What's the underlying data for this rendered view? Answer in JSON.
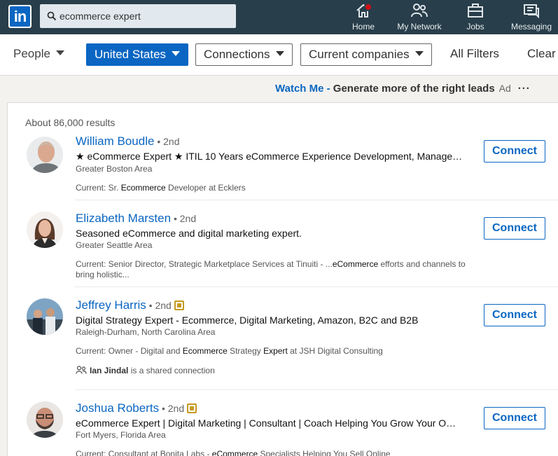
{
  "nav": {
    "logo_text": "in",
    "search_value": "ecommerce expert",
    "items": [
      {
        "label": "Home",
        "icon": "home-icon"
      },
      {
        "label": "My Network",
        "icon": "network-icon"
      },
      {
        "label": "Jobs",
        "icon": "briefcase-icon"
      },
      {
        "label": "Messaging",
        "icon": "messaging-icon"
      }
    ]
  },
  "filters": {
    "people": "People",
    "location": "United States",
    "connections": "Connections",
    "companies": "Current companies",
    "all_filters": "All Filters",
    "clear": "Clear"
  },
  "ad": {
    "link": "Watch Me - ",
    "text": "Generate more of the right leads",
    "tag": "Ad",
    "more": "···"
  },
  "results": {
    "count_text": "About 86,000 results",
    "people": [
      {
        "name": "William Boudle",
        "degree": " • 2nd",
        "premium": false,
        "headline": "★ eCommerce Expert ★ ITIL 10 Years eCommerce Experience Development, Manage…",
        "location": "Greater Boston Area",
        "snippet_pre": "Current: Sr. ",
        "snippet_hl": "Ecommerce",
        "snippet_post": " Developer at Ecklers",
        "connect": "Connect"
      },
      {
        "name": "Elizabeth Marsten",
        "degree": " • 2nd",
        "premium": false,
        "headline": "Seasoned eCommerce and digital marketing expert.",
        "location": "Greater Seattle Area",
        "snippet_pre": "Current: Senior Director, Strategic Marketplace Services at Tinuiti - ...",
        "snippet_hl": "eCommerce",
        "snippet_post": " efforts and channels to bring holistic...",
        "connect": "Connect"
      },
      {
        "name": "Jeffrey Harris",
        "degree": " • 2nd",
        "premium": true,
        "headline": "Digital Strategy Expert - Ecommerce, Digital Marketing, Amazon, B2C and B2B",
        "location": "Raleigh-Durham, North Carolina Area",
        "snippet_pre": "Current: Owner - Digital and ",
        "snippet_hl": "Ecommerce",
        "snippet_mid": " Strategy ",
        "snippet_hl2": "Expert",
        "snippet_post": " at JSH Digital Consulting",
        "shared_name": "Ian Jindal",
        "shared_text": " is a shared connection",
        "connect": "Connect"
      },
      {
        "name": "Joshua Roberts",
        "degree": " • 2nd",
        "premium": true,
        "headline": "eCommerce Expert | Digital Marketing | Consultant | Coach Helping You Grow Your O…",
        "location": "Fort Myers, Florida Area",
        "snippet_pre": "Current: Consultant at Bonita Labs - ",
        "snippet_hl": "eCommerce",
        "snippet_post": " Specialists Helping You Sell Online",
        "connect": "Connect"
      }
    ]
  },
  "colors": {
    "nav_bg": "#283e4a",
    "brand_blue": "#0a66c2",
    "premium_gold": "#c49a22",
    "notification_red": "#cc1016"
  }
}
